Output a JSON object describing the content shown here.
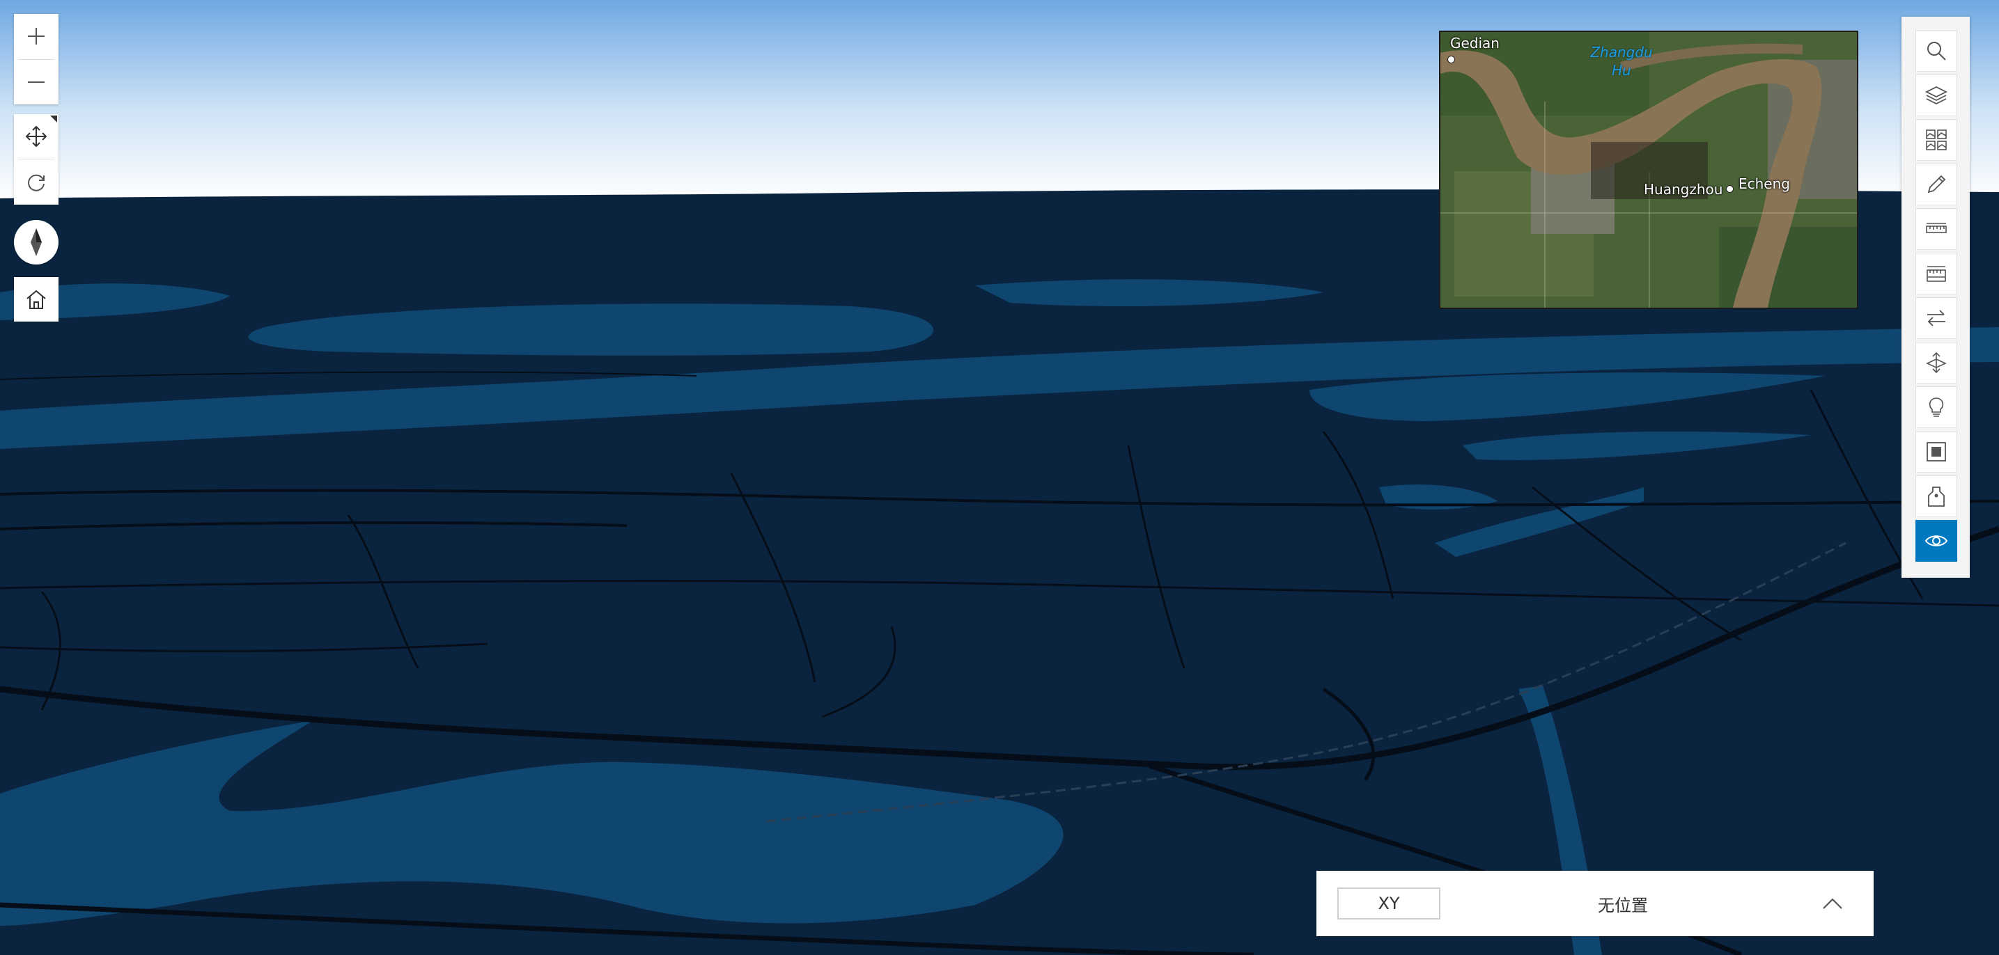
{
  "scene": {
    "sky_top_color": "#6fa8e2",
    "sky_bottom_color": "#ffffff",
    "ground_color": "#0a2440",
    "water_color": "#0f4670",
    "road_color": "#050e18"
  },
  "navigation": {
    "zoom_in_icon": "plus-icon",
    "zoom_out_icon": "minus-icon",
    "pan_icon": "move-arrows-icon",
    "rotate_icon": "rotate-icon",
    "compass_icon": "compass-needle-icon",
    "home_icon": "home-icon"
  },
  "overview_map": {
    "labels": {
      "gedian": "Gedian",
      "zhangdu": "Zhangdu\nHu",
      "huangzhou": "Huangzhou",
      "echeng": "Echeng"
    }
  },
  "toolbar": {
    "tools": [
      {
        "name": "search",
        "icon": "search-icon",
        "active": false
      },
      {
        "name": "layers",
        "icon": "layers-icon",
        "active": false
      },
      {
        "name": "basemap-gallery",
        "icon": "basemap-gallery-icon",
        "active": false
      },
      {
        "name": "sketch",
        "icon": "pencil-icon",
        "active": false
      },
      {
        "name": "measure-distance",
        "icon": "ruler-icon",
        "active": false
      },
      {
        "name": "measure-area",
        "icon": "area-measure-icon",
        "active": false
      },
      {
        "name": "swipe",
        "icon": "swap-arrows-icon",
        "active": false
      },
      {
        "name": "elevation",
        "icon": "elevation-arrows-icon",
        "active": false
      },
      {
        "name": "daylight",
        "icon": "lightbulb-icon",
        "active": false
      },
      {
        "name": "slice",
        "icon": "stop-square-icon",
        "active": false
      },
      {
        "name": "bookmark",
        "icon": "tag-icon",
        "active": false
      },
      {
        "name": "line-of-sight",
        "icon": "eye-icon",
        "active": true
      }
    ],
    "active_color": "#0079c1"
  },
  "coordinate_bar": {
    "mode_label": "XY",
    "position_text": "无位置",
    "expand_icon": "chevron-up-icon"
  }
}
